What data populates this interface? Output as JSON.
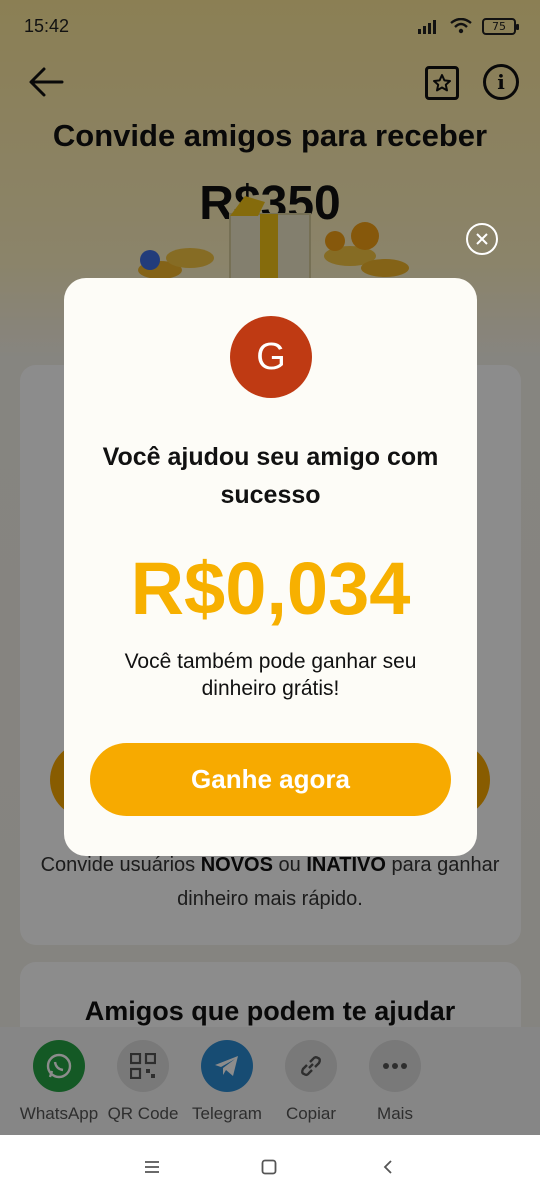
{
  "status_bar": {
    "time": "15:42",
    "battery": "75"
  },
  "header": {
    "title": "Convide amigos para receber",
    "reward": "R$350"
  },
  "background": {
    "note_prefix": "Convide usuários ",
    "note_new": "NOVOS",
    "note_or": " ou ",
    "note_inactive": "INATIVO",
    "note_suffix": " para ganhar dinheiro mais rápido.",
    "friends_title": "Amigos que podem te ajudar"
  },
  "share": {
    "items": [
      {
        "label": "WhatsApp",
        "color": "#25a244",
        "icon": "whatsapp-icon"
      },
      {
        "label": "QR Code",
        "color": "#dcdcdc",
        "icon": "qr-code-icon"
      },
      {
        "label": "Telegram",
        "color": "#2b8bd2",
        "icon": "telegram-icon"
      },
      {
        "label": "Copiar",
        "color": "#dcdcdc",
        "icon": "link-icon"
      },
      {
        "label": "Mais",
        "color": "#dcdcdc",
        "icon": "more-icon"
      }
    ]
  },
  "modal": {
    "avatar_letter": "G",
    "title": "Você ajudou seu amigo com sucesso",
    "amount": "R$0,034",
    "subtitle": "Você também pode ganhar seu dinheiro grátis!",
    "cta": "Ganhe agora",
    "accent": "#f7aa00",
    "avatar_color": "#bf3a13"
  }
}
